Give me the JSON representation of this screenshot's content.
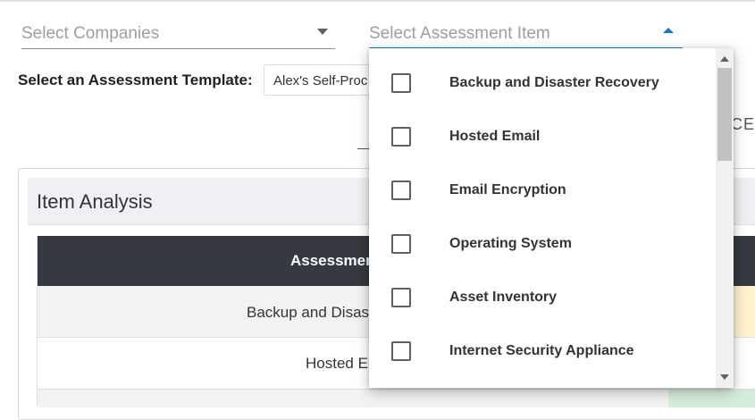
{
  "filters": {
    "companies_placeholder": "Select Companies",
    "assessment_placeholder": "Select Assessment Item"
  },
  "template": {
    "label": "Select an Assessment Template:",
    "value": "Alex's Self-Proc"
  },
  "partial_tab_text": "CE",
  "item_analysis": {
    "title": "Item Analysis",
    "column_header": "Assessmen",
    "rows": [
      {
        "label": "Backup and Disas",
        "status_color": "#fff3cd"
      },
      {
        "label": "Hosted E",
        "status_color": "#ffffff"
      },
      {
        "label": "",
        "status_color": "#d4edda"
      }
    ]
  },
  "dropdown": {
    "options": [
      {
        "label": "Backup and Disaster Recovery",
        "checked": false
      },
      {
        "label": "Hosted Email",
        "checked": false
      },
      {
        "label": "Email Encryption",
        "checked": false
      },
      {
        "label": "Operating System",
        "checked": false
      },
      {
        "label": "Asset Inventory",
        "checked": false
      },
      {
        "label": "Internet Security Appliance",
        "checked": false
      }
    ]
  },
  "colors": {
    "accent": "#1976d2",
    "table_header": "#343a40"
  }
}
